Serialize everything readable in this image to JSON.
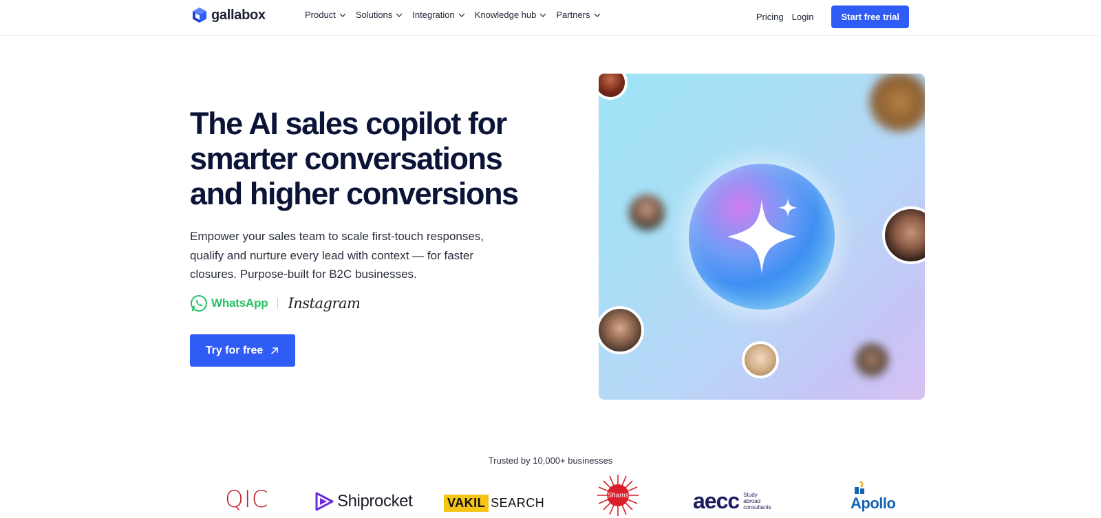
{
  "brand": {
    "name": "gallabox",
    "color": "#2f5cf5"
  },
  "nav": {
    "menu": [
      {
        "label": "Product"
      },
      {
        "label": "Solutions"
      },
      {
        "label": "Integration"
      },
      {
        "label": "Knowledge hub"
      },
      {
        "label": "Partners"
      }
    ],
    "pricing": "Pricing",
    "login": "Login",
    "cta": "Start free trial"
  },
  "hero": {
    "title": "The AI sales copilot for smarter conversations and higher conversions",
    "subtitle": "Empower your sales team to scale first-touch responses, qualify and nurture every lead with context — for faster closures. Purpose-built for B2C businesses.",
    "channels": {
      "whatsapp": "WhatsApp",
      "instagram": "Instagram"
    },
    "cta": "Try for free"
  },
  "trusted": {
    "label": "Trusted by 10,000+ businesses",
    "logos": {
      "qic": "QIC",
      "shiprocket": "Shiprocket",
      "vakil_a": "VAKIL",
      "vakil_b": "SEARCH",
      "shams": "Shams",
      "aecc": "aecc",
      "aecc_tag": "Study abroad consultants",
      "apollo": "Apollo"
    }
  },
  "icons": [
    "logo-cube-icon",
    "chevron-down-icon",
    "whatsapp-icon",
    "arrow-up-right-icon",
    "sparkle-icon"
  ]
}
